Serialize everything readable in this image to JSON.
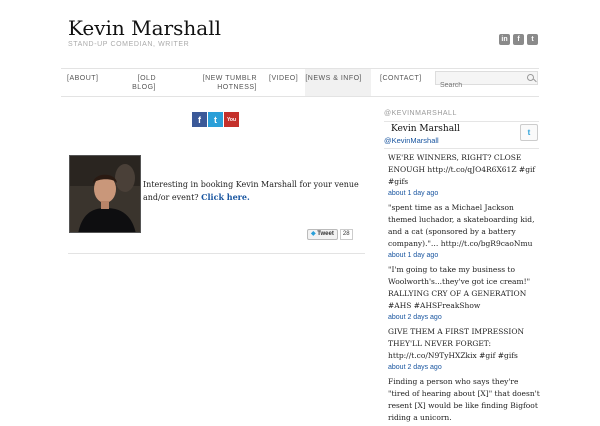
{
  "header": {
    "title": "Kevin Marshall",
    "tagline": "STAND-UP COMEDIAN, WRITER",
    "social": [
      {
        "icon": "linkedin-icon",
        "glyph": "in"
      },
      {
        "icon": "facebook-icon",
        "glyph": "f"
      },
      {
        "icon": "twitter-icon",
        "glyph": "t"
      }
    ]
  },
  "nav": {
    "items": [
      {
        "label": "[ABOUT]"
      },
      {
        "label": "[OLD BLOG]"
      },
      {
        "label": "[NEW TUMBLR HOTNESS]"
      },
      {
        "label": "[VIDEO]"
      },
      {
        "label": "[NEWS & INFO]"
      },
      {
        "label": "[CONTACT]"
      }
    ],
    "search_placeholder": "Search"
  },
  "main": {
    "share_icons": [
      {
        "icon": "facebook-icon",
        "glyph": "f",
        "color": "#3b5998"
      },
      {
        "icon": "twitter-icon",
        "glyph": "t",
        "color": "#2a9fd8"
      },
      {
        "icon": "youtube-icon",
        "glyph": "You",
        "color": "#c4302b"
      }
    ],
    "booking_text": "Interesting in booking Kevin Marshall for your venue and/or event?",
    "booking_link": "Click here.",
    "tweet_label": "Tweet",
    "tweet_count": "28"
  },
  "sidebar": {
    "widget_title": "@KEVINMARSHALL",
    "name": "Kevin Marshall",
    "handle": "@KevinMarshall",
    "tweets": [
      {
        "text": "WE'RE WINNERS, RIGHT? CLOSE ENOUGH http://t.co/qJO4R6X61Z #gif #gifs",
        "time": "about 1 day ago"
      },
      {
        "text": "\"spent time as a Michael Jackson themed luchador, a skateboarding kid, and a cat (sponsored by a battery company).\"… http://t.co/bgR9caoNmu",
        "time": "about 1 day ago"
      },
      {
        "text": "\"I'm going to take my business to Woolworth's...they've got ice cream!\" RALLYING CRY OF A GENERATION #AHS #AHSFreakShow",
        "time": "about 2 days ago"
      },
      {
        "text": "GIVE THEM A FIRST IMPRESSION THEY'LL NEVER FORGET: http://t.co/N9TyHXZkix #gif #gifs",
        "time": "about 2 days ago"
      },
      {
        "text": "Finding a person who says they're \"tired of hearing about [X]\" that doesn't resent [X] would be like finding Bigfoot riding a unicorn.",
        "time": ""
      }
    ]
  },
  "colors": {
    "link": "#1a56a0",
    "facebook": "#3b5998",
    "twitter": "#2a9fd8",
    "youtube": "#c4302b"
  }
}
